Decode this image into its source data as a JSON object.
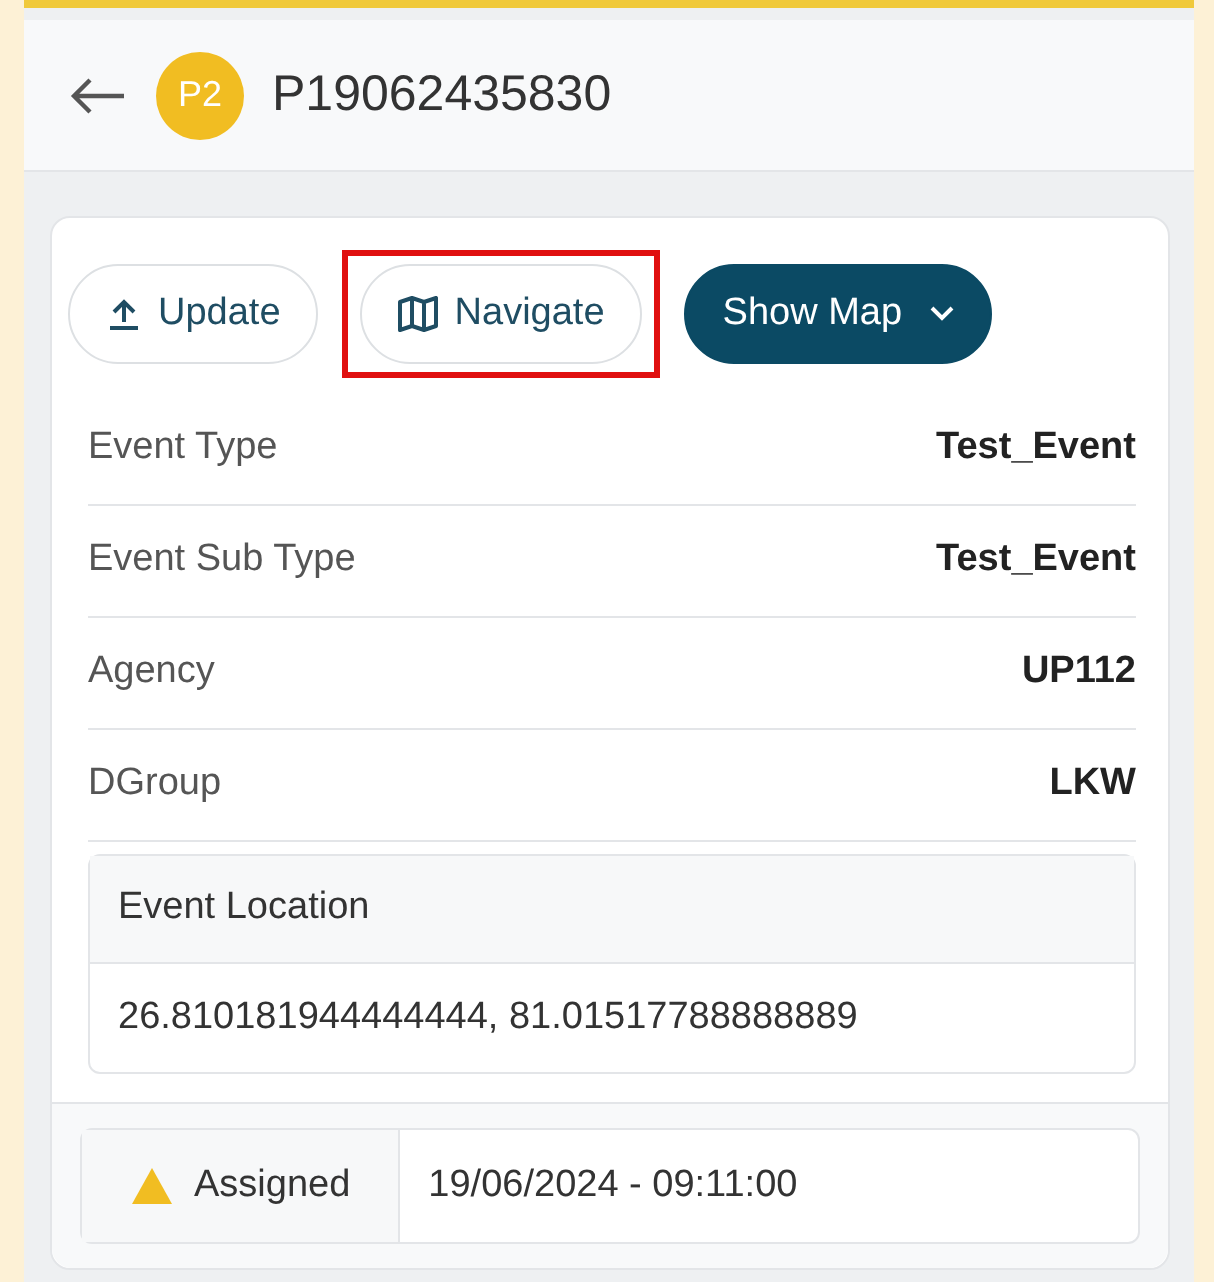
{
  "header": {
    "badge": "P2",
    "title": "P19062435830"
  },
  "actions": [
    {
      "kind": "upload",
      "label": "Update",
      "highlighted": false
    },
    {
      "kind": "map",
      "label": "Navigate",
      "highlighted": true
    },
    {
      "kind": "dropdown",
      "label": "Show Map",
      "highlighted": false
    }
  ],
  "fields": [
    {
      "label": "Event Type",
      "value": "Test_Event"
    },
    {
      "label": "Event Sub Type",
      "value": "Test_Event"
    },
    {
      "label": "Agency",
      "value": "UP112"
    },
    {
      "label": "DGroup",
      "value": "LKW"
    }
  ],
  "location": {
    "label": "Event Location",
    "value": "26.810181944444444, 81.01517788888889"
  },
  "status": {
    "label": "Assigned",
    "time": "19/06/2024 - 09:11:00"
  }
}
